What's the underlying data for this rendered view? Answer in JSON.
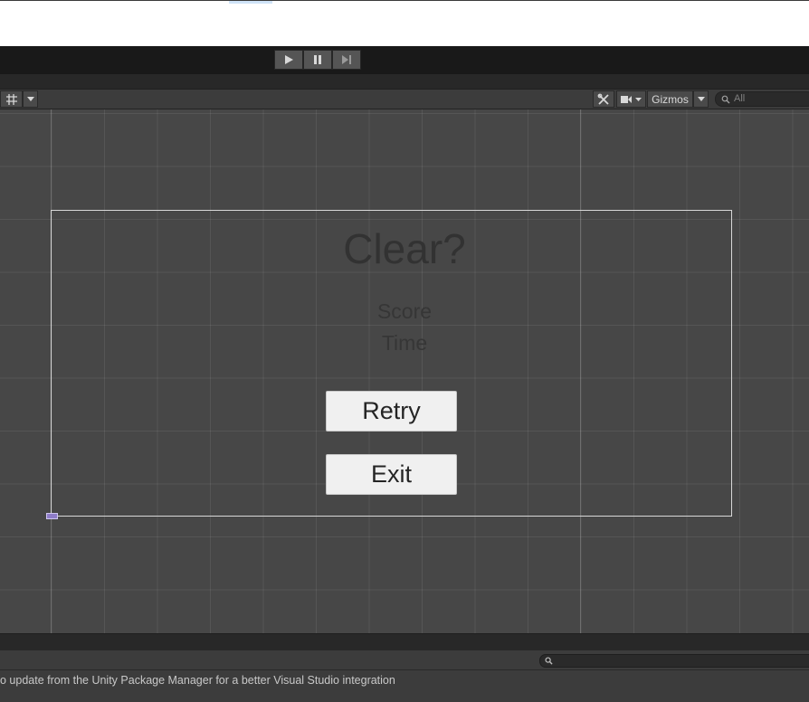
{
  "playbar": {
    "buttons": [
      {
        "name": "play-icon"
      },
      {
        "name": "pause-icon"
      },
      {
        "name": "step-icon"
      }
    ]
  },
  "scene_toolbar": {
    "gizmos_label": "Gizmos",
    "search_placeholder": "All",
    "icons": [
      "grid-snap-icon",
      "dropdown-arrow-icon",
      "tools-icon",
      "camera-icon",
      "search-icon"
    ]
  },
  "game_ui": {
    "title": "Clear?",
    "score_label": "Score",
    "time_label": "Time",
    "retry_label": "Retry",
    "exit_label": "Exit"
  },
  "console": {
    "message": "o update from the Unity Package Manager for a better Visual Studio integration"
  },
  "colors": {
    "scene_background": "#474747",
    "canvas_frame": "#d8d8d8",
    "button_face": "#f0f0f0",
    "pivot_marker": "#8e7cc8"
  }
}
